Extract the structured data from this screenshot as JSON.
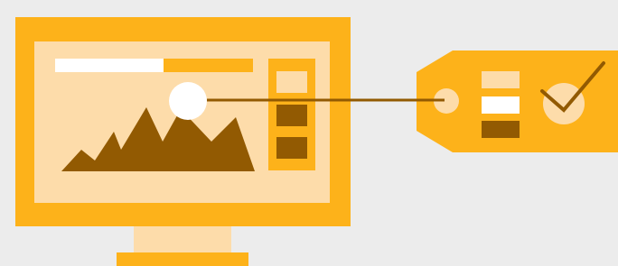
{
  "illustration": {
    "subject": "monitor-with-image-and-price-tag",
    "colors": {
      "background": "#ececec",
      "amber": "#fdb21a",
      "cream": "#fddcaa",
      "brown": "#925a02",
      "white": "#ffffff"
    },
    "icons": [
      "monitor-icon",
      "mountain-image-icon",
      "sun-icon",
      "progress-bar",
      "sidebar-panel",
      "connector-line",
      "tag-icon",
      "checkmark-icon"
    ],
    "progress_fraction": 0.55
  }
}
